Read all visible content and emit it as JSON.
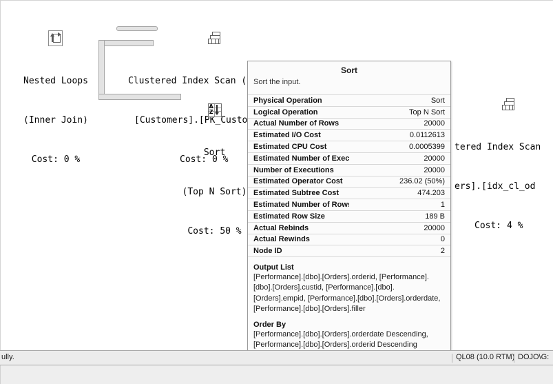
{
  "plan": {
    "operators": [
      {
        "id": "nested-loops",
        "icon": "nested-loops-icon",
        "line1": "Nested Loops",
        "line2": "(Inner Join)",
        "line3": "Cost: 0 %"
      },
      {
        "id": "clustered-index-scan-customers",
        "icon": "clustered-index-scan-icon",
        "line1": "Clustered Index Scan (Cl…",
        "line2": "[Customers].[PK_Customer…",
        "line3": "Cost: 0 %"
      },
      {
        "id": "sort",
        "icon": "sort-icon",
        "line1": "Sort",
        "line2": "(Top N Sort)",
        "line3": "Cost: 50 %"
      },
      {
        "id": "clustered-index-scan-orders",
        "icon": "clustered-index-scan-icon",
        "line1": "tered Index Scan",
        "line2": "ers].[idx_cl_od",
        "line3": "Cost: 4 %"
      }
    ]
  },
  "tooltip": {
    "title": "Sort",
    "description": "Sort the input.",
    "properties": [
      {
        "key": "Physical Operation",
        "value": "Sort"
      },
      {
        "key": "Logical Operation",
        "value": "Top N Sort"
      },
      {
        "key": "Actual Number of Rows",
        "value": "20000"
      },
      {
        "key": "Estimated I/O Cost",
        "value": "0.0112613"
      },
      {
        "key": "Estimated CPU Cost",
        "value": "0.0005399"
      },
      {
        "key": "Estimated Number of Executions",
        "value": "20000"
      },
      {
        "key": "Number of Executions",
        "value": "20000"
      },
      {
        "key": "Estimated Operator Cost",
        "value": "236.02 (50%)"
      },
      {
        "key": "Estimated Subtree Cost",
        "value": "474.203"
      },
      {
        "key": "Estimated Number of Rows",
        "value": "1"
      },
      {
        "key": "Estimated Row Size",
        "value": "189 B"
      },
      {
        "key": "Actual Rebinds",
        "value": "20000"
      },
      {
        "key": "Actual Rewinds",
        "value": "0"
      },
      {
        "key": "Node ID",
        "value": "2"
      }
    ],
    "output_list": {
      "heading": "Output List",
      "text": "[Performance].[dbo].[Orders].orderid, [Performance].[dbo].[Orders].custid, [Performance].[dbo].[Orders].empid, [Performance].[dbo].[Orders].orderdate, [Performance].[dbo].[Orders].filler"
    },
    "order_by": {
      "heading": "Order By",
      "text": "[Performance].[dbo].[Orders].orderdate Descending, [Performance].[dbo].[Orders].orderid Descending"
    }
  },
  "status": {
    "message": "ully.",
    "server": "QL08 (10.0 RTM)",
    "user": "DOJO\\G:"
  }
}
